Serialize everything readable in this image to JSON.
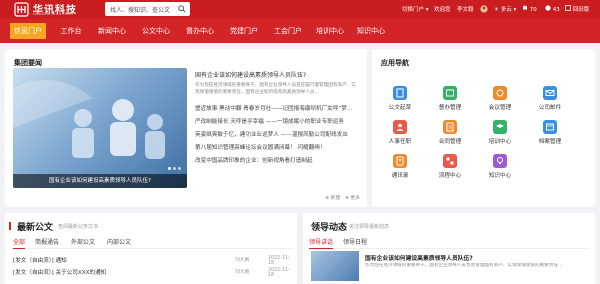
{
  "header": {
    "logo_cn": "华讯科技",
    "logo_en": "HUAXUN HIGH-TECH",
    "search_placeholder": "找人、搜知识、查公文",
    "switch_portal": "切换门户",
    "welcome": "欢迎您",
    "user": "李文毅",
    "weather": "多云",
    "notifications_count": "70",
    "messages_count": "43",
    "return_old": "回旧版"
  },
  "nav": [
    "信息门户",
    "工作台",
    "新闻中心",
    "公文中心",
    "督办中心",
    "党建门户",
    "工会门户",
    "培训中心",
    "知识中心"
  ],
  "news_panel": {
    "title": "集团要闻",
    "image_caption": "国有企业该如何建设高素质领导人员队伍?",
    "headline": "国有企业该如何建设高素质领导人员队伍?",
    "desc": "作为现在经济领域的重要骨干，国有企业领导人员是在履行着管理国有资产、实现保值增值的重要责任，国有企业如何培育高素质领导人员…",
    "lines": [
      "塑近故事 黑动中翻 青春岁月社——记团报海康坝机厂女呼”梦…",
      "严改制能接长 天呼是乎幸福 ——一镜成眠小的职业专职运务",
      "英姿飒爽敏于忆，建功业业巡梦人 ——温报风勤公司配线发出",
      "第八届知识管理高峰论坛会议圆满闭幕！ 闪耀翻闸！",
      "改变中国品牌印象的企业：创新视角看打造制起"
    ],
    "action_new": "新建",
    "action_more": "更多"
  },
  "apps_panel": {
    "title": "应用导航",
    "apps": [
      {
        "label": "公文起草",
        "color": "#3b8fe3",
        "icon": "document-edit-icon"
      },
      {
        "label": "督办管理",
        "color": "#35b06b",
        "icon": "supervise-icon"
      },
      {
        "label": "会议管理",
        "color": "#ef8a2f",
        "icon": "meeting-icon"
      },
      {
        "label": "公司邮件",
        "color": "#3b8fe3",
        "icon": "mail-icon"
      },
      {
        "label": "人事任职",
        "color": "#e65b4a",
        "icon": "personnel-icon"
      },
      {
        "label": "合同管理",
        "color": "#ef8a2f",
        "icon": "contract-icon"
      },
      {
        "label": "培训中心",
        "color": "#35b06b",
        "icon": "training-icon"
      },
      {
        "label": "档案管理",
        "color": "#3b8fe3",
        "icon": "archive-icon"
      },
      {
        "label": "通讯录",
        "color": "#ef8a2f",
        "icon": "contacts-icon"
      },
      {
        "label": "流程中心",
        "color": "#e65b4a",
        "icon": "workflow-icon"
      },
      {
        "label": "知识中心",
        "color": "#9d5bd2",
        "icon": "knowledge-icon"
      }
    ]
  },
  "docs_panel": {
    "title": "最新公文",
    "subtitle": "查阅最新公务文书",
    "tabs": [
      "全部",
      "简报通告",
      "外部公文",
      "内部公文"
    ],
    "rows": [
      {
        "title": "[发文（自由流）] 通知",
        "who": "刘大鹏",
        "when": "2022-11-18"
      },
      {
        "title": "[发文（自由流）] 关于公司XXX的通知",
        "who": "刘大鹏",
        "when": "2022-11-18"
      }
    ]
  },
  "leader_panel": {
    "title": "领导动态",
    "subtitle": "关注领导最新动态",
    "tabs": [
      "领导讲话",
      "领导日程"
    ],
    "headline": "国有企业该如何建设高素质领导人员队伍?",
    "desc": "作为现在经济领域的重要骨干，国有企业领导人员负责管理国有资产、实现保值增值的重要责任…"
  },
  "colors": {
    "brand_red": "#d32428",
    "active_tab": "#f5a623"
  }
}
